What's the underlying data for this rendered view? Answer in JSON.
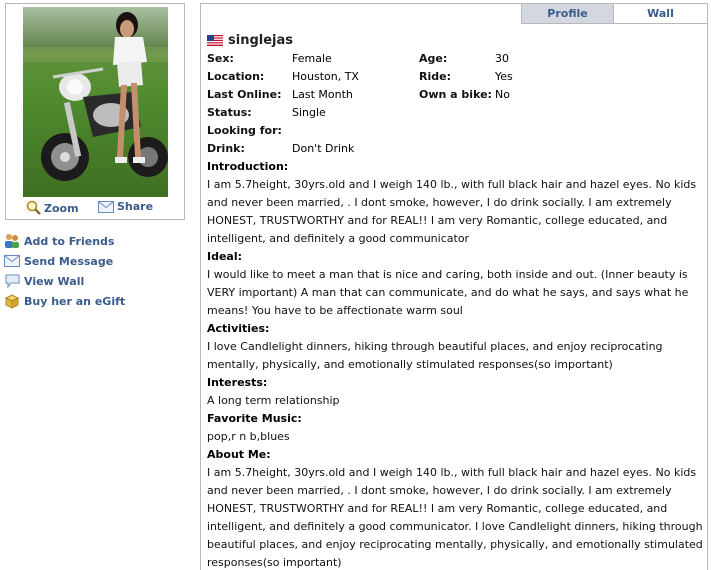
{
  "photo_actions": {
    "zoom": "Zoom",
    "share": "Share"
  },
  "side_links": [
    {
      "label": "Add to Friends",
      "icon": "add-friends-icon"
    },
    {
      "label": "Send Message",
      "icon": "envelope-icon"
    },
    {
      "label": "View Wall",
      "icon": "speech-bubble-icon"
    },
    {
      "label": "Buy her an eGift",
      "icon": "gift-box-icon"
    }
  ],
  "tabs": {
    "profile": "Profile",
    "wall": "Wall"
  },
  "profile": {
    "username": "singlejas",
    "sex_label": "Sex:",
    "sex": "Female",
    "age_label": "Age:",
    "age": "30",
    "location_label": "Location:",
    "location": "Houston, TX",
    "ride_label": "Ride:",
    "ride": "Yes",
    "last_online_label": "Last Online:",
    "last_online": "Last Month",
    "own_bike_label": "Own a bike:",
    "own_bike": "No",
    "status_label": "Status:",
    "status": "Single",
    "looking_label": "Looking for:",
    "looking": "",
    "drink_label": "Drink:",
    "drink": "Don't Drink"
  },
  "sections": {
    "intro_label": "Introduction:",
    "intro": "I am 5.7height, 30yrs.old and I weigh 140 lb., with full black hair and hazel eyes. No kids and never been married, . I dont smoke, however, I do drink socially. I am extremely HONEST, TRUSTWORTHY and for REAL!! I am very Romantic, college educated, and intelligent, and definitely a good communicator",
    "ideal_label": "Ideal:",
    "ideal": "I would like to meet a man that is nice and caring, both inside and out. (Inner beauty is VERY important) A man that can communicate, and do what he says, and says what he means! You have to be affectionate warm soul",
    "activities_label": "Activities:",
    "activities": "I love Candlelight dinners, hiking through beautiful places, and enjoy reciprocating mentally, physically, and emotionally stimulated responses(so important)",
    "interests_label": "Interests:",
    "interests": "A long term relationship",
    "music_label": "Favorite Music:",
    "music": "pop,r n b,blues",
    "about_label": "About Me:",
    "about": "I am 5.7height, 30yrs.old and I weigh 140 lb., with full black hair and hazel eyes. No kids and never been married, . I dont smoke, however, I do drink socially. I am extremely HONEST, TRUSTWORTHY and for REAL!! I am very Romantic, college educated, and intelligent, and definitely a good communicator. I love Candlelight dinners, hiking through beautiful places, and enjoy reciprocating mentally, physically, and emotionally stimulated responses(so important)"
  },
  "colors": {
    "link": "#3a5b8c",
    "border": "#b8b8b8",
    "active_tab": "#d3d8e0"
  }
}
